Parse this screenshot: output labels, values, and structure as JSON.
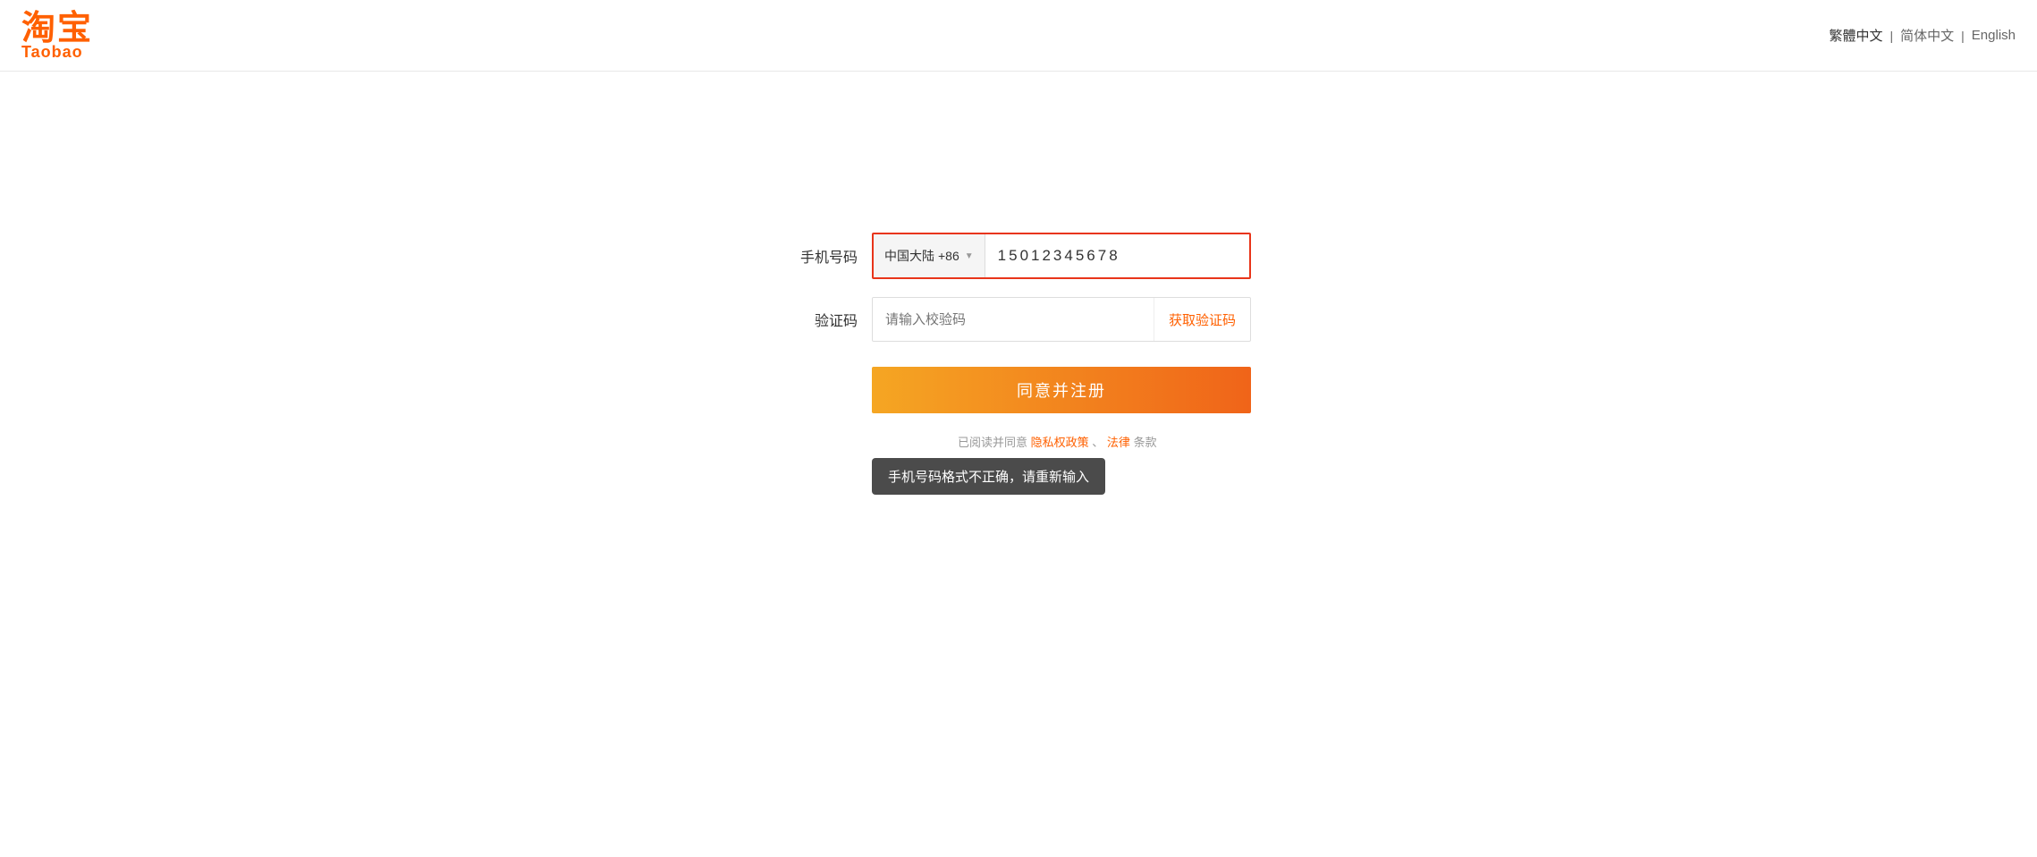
{
  "header": {
    "logo_chinese": "淘宝",
    "logo_english": "Taobao",
    "lang_options": [
      {
        "label": "繁體中文",
        "active": false
      },
      {
        "label": "简体中文",
        "active": false
      },
      {
        "label": "English",
        "active": true
      }
    ]
  },
  "form": {
    "phone_label": "手机号码",
    "country_name": "中国大陆",
    "country_code": "+86",
    "phone_value": "15012345678",
    "phone_display": "1 5 0 1 2 3 4 5 6 7 8",
    "verif_label": "验证码",
    "verif_placeholder": "请输入校验码",
    "get_verif_btn": "获取验证码",
    "submit_btn": "同意并注册",
    "agreement_prefix": "已阅读并同意",
    "agreement_links": [
      "隐私政策",
      "法律"
    ],
    "agreement_suffix": "条款",
    "error_msg": "手机号码格式不正确，请重新输入"
  },
  "colors": {
    "brand_orange": "#ff6000",
    "error_red": "#e8351a",
    "btn_gradient_start": "#f5a623",
    "btn_gradient_end": "#f06419",
    "tooltip_bg": "rgba(50,50,50,0.88)"
  }
}
